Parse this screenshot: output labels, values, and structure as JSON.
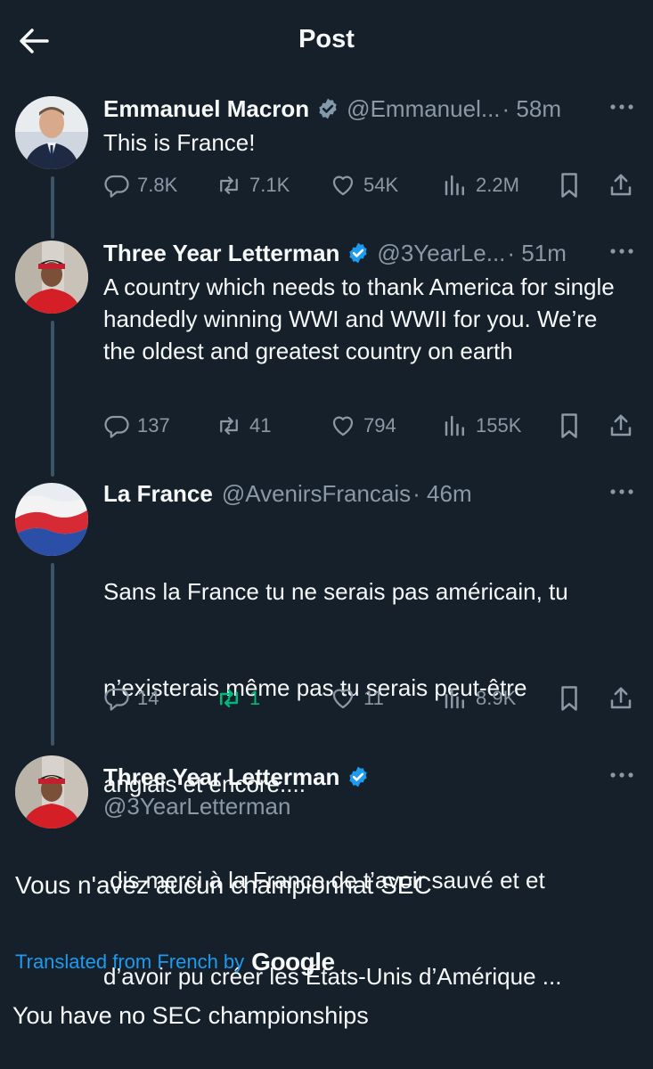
{
  "header": {
    "title": "Post"
  },
  "tweets": [
    {
      "name": "Emmanuel Macron",
      "handle": "@Emmanuel...",
      "time": "· 58m",
      "text": "This is France!",
      "replies": "7.8K",
      "reposts": "7.1K",
      "likes": "54K",
      "views": "2.2M"
    },
    {
      "name": "Three Year Letterman",
      "handle": "@3YearLe...",
      "time": "· 51m",
      "text": "A country which needs to thank America for single handedly winning WWI and WWII for you. We’re the oldest and greatest country on earth",
      "replies": "137",
      "reposts": "41",
      "likes": "794",
      "views": "155K"
    },
    {
      "name": "La France",
      "handle": "@AvenirsFrancais",
      "time": "· 46m",
      "text_lines": [
        "Sans la France tu ne serais pas américain, tu",
        "n’existerais même pas tu serais peut-être",
        "anglais et encore....",
        " dis merci à la France de t’avoir sauvé et et",
        "d’avoir pu créer les États-Unis d’Amérique ..."
      ],
      "replies": "14",
      "reposts": "1",
      "likes": "11",
      "views": "8.9K"
    }
  ],
  "main_tweet": {
    "name": "Three Year Letterman",
    "handle": "@3YearLetterman",
    "text": "Vous n'avez aucun championnat SEC",
    "translated_label": "Translated from French by",
    "translator": "Google",
    "translation": "You have no SEC championships"
  },
  "colors": {
    "background": "#15202b",
    "accent": "#1d9bf0",
    "muted": "#8b98a5",
    "repost_active": "#00ba7c"
  }
}
